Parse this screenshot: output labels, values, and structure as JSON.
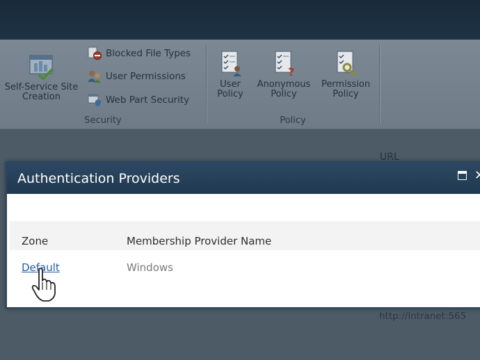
{
  "ribbon": {
    "security": {
      "label": "Security",
      "self_service": "Self-Service Site Creation",
      "blocked_file_types": "Blocked File Types",
      "user_permissions": "User Permissions",
      "web_part_security": "Web Part Security"
    },
    "policy": {
      "label": "Policy",
      "user_policy": "User Policy",
      "anonymous_policy": "Anonymous Policy",
      "permission_policy": "Permission Policy"
    }
  },
  "background": {
    "url_header": "URL",
    "url_value": "http://intranet:565"
  },
  "dialog": {
    "title": "Authentication Providers",
    "columns": [
      "Zone",
      "Membership Provider Name"
    ],
    "rows": [
      {
        "zone": "Default",
        "provider": "Windows"
      }
    ]
  },
  "colors": {
    "title_bar": "#233d55",
    "link": "#1f5faa",
    "overlay": "#4c5b66"
  }
}
